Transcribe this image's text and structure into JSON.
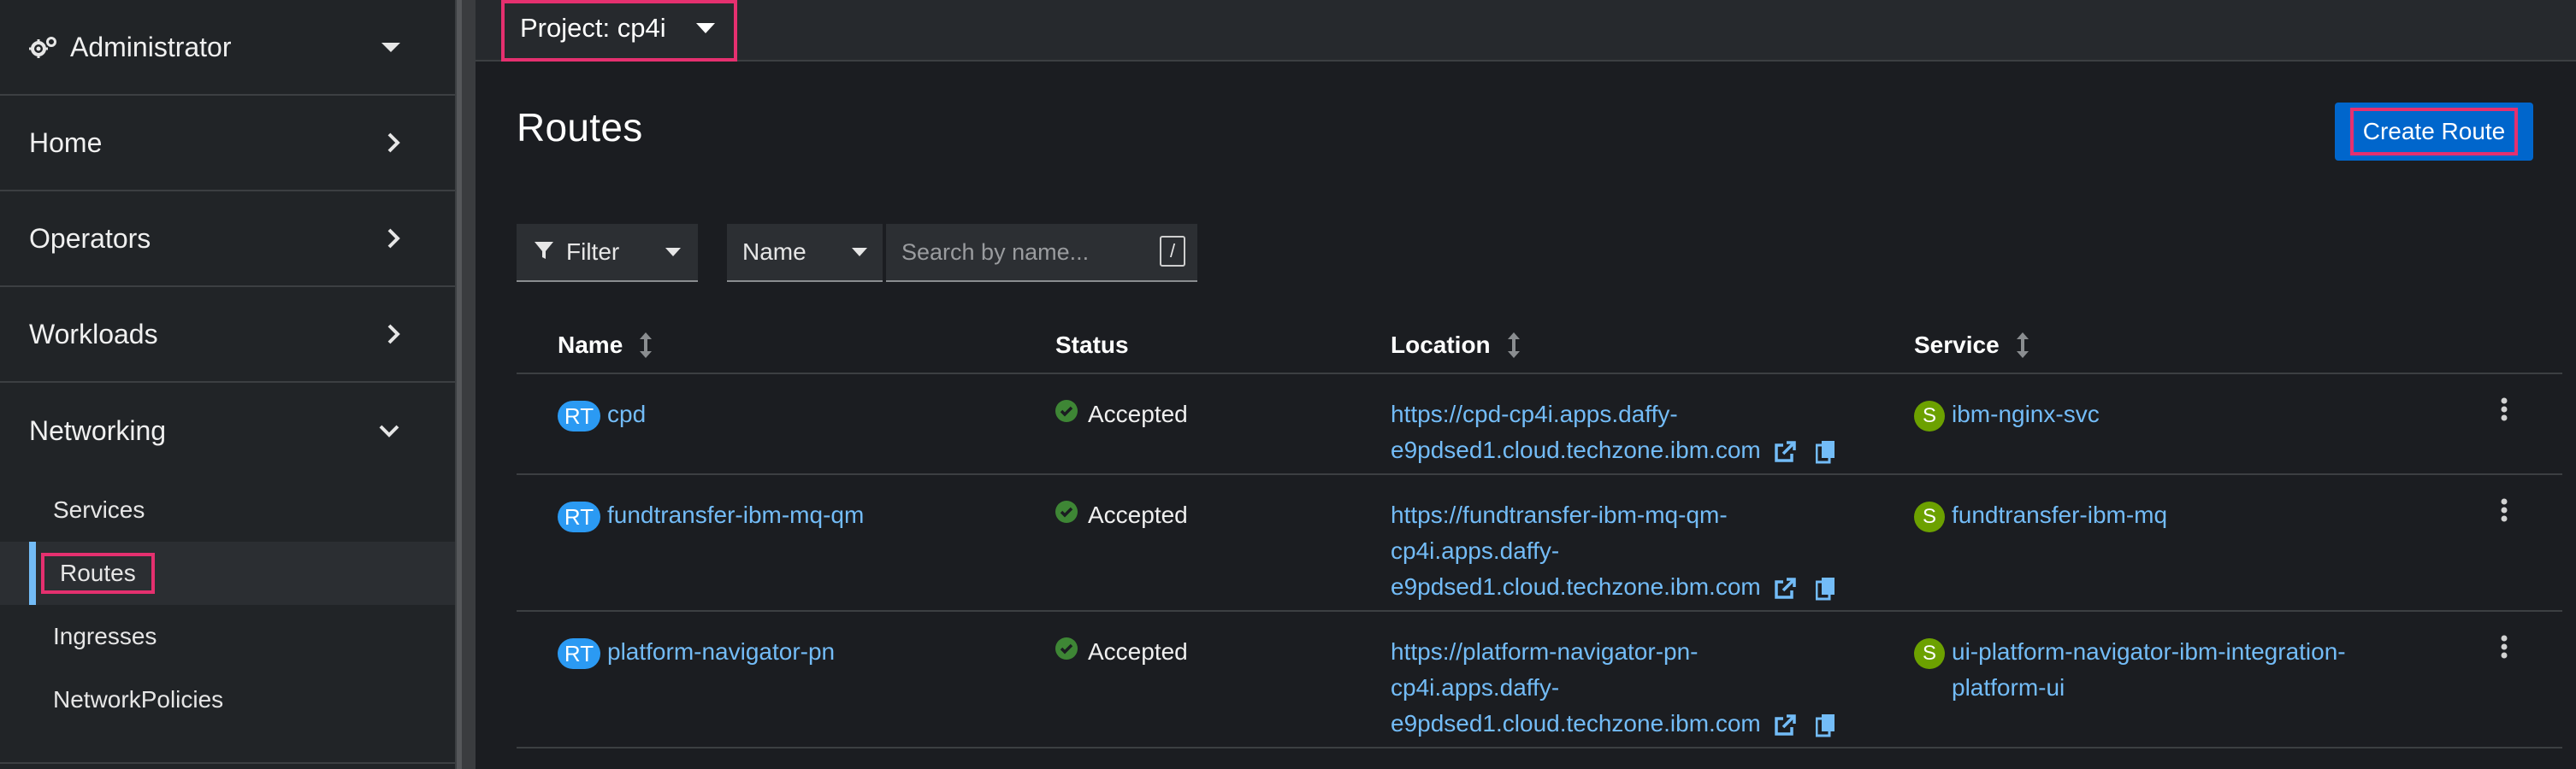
{
  "sidebar": {
    "perspective": "Administrator",
    "sections": [
      {
        "label": "Home"
      },
      {
        "label": "Operators"
      },
      {
        "label": "Workloads"
      }
    ],
    "networking": {
      "label": "Networking",
      "items": [
        {
          "label": "Services"
        },
        {
          "label": "Routes"
        },
        {
          "label": "Ingresses"
        },
        {
          "label": "NetworkPolicies"
        }
      ]
    }
  },
  "project_bar": {
    "label": "Project: cp4i"
  },
  "page": {
    "title": "Routes",
    "create_button": "Create Route"
  },
  "toolbar": {
    "filter_label": "Filter",
    "name_select": "Name",
    "search_placeholder": "Search by name...",
    "shortcut": "/"
  },
  "table": {
    "columns": {
      "name": "Name",
      "status": "Status",
      "location": "Location",
      "service": "Service"
    },
    "rows": [
      {
        "badge": "RT",
        "name": "cpd",
        "status": "Accepted",
        "location_lines": [
          "https://cpd-cp4i.apps.daffy-",
          "e9pdsed1.cloud.techzone.ibm.com"
        ],
        "service_badge": "S",
        "service_lines": [
          "ibm-nginx-svc"
        ]
      },
      {
        "badge": "RT",
        "name": "fundtransfer-ibm-mq-qm",
        "status": "Accepted",
        "location_lines": [
          "https://fundtransfer-ibm-mq-qm-",
          "cp4i.apps.daffy-",
          "e9pdsed1.cloud.techzone.ibm.com"
        ],
        "service_badge": "S",
        "service_lines": [
          "fundtransfer-ibm-mq"
        ]
      },
      {
        "badge": "RT",
        "name": "platform-navigator-pn",
        "status": "Accepted",
        "location_lines": [
          "https://platform-navigator-pn-",
          "cp4i.apps.daffy-",
          "e9pdsed1.cloud.techzone.ibm.com"
        ],
        "service_badge": "S",
        "service_lines": [
          "ui-platform-navigator-ibm-integration-",
          "platform-ui"
        ]
      }
    ]
  },
  "colors": {
    "accent": "#0066cc",
    "link": "#73bcf7",
    "highlight": "#e5306f",
    "success": "#3e8635",
    "route_badge": "#2b9af3",
    "service_badge": "#6ca100"
  }
}
